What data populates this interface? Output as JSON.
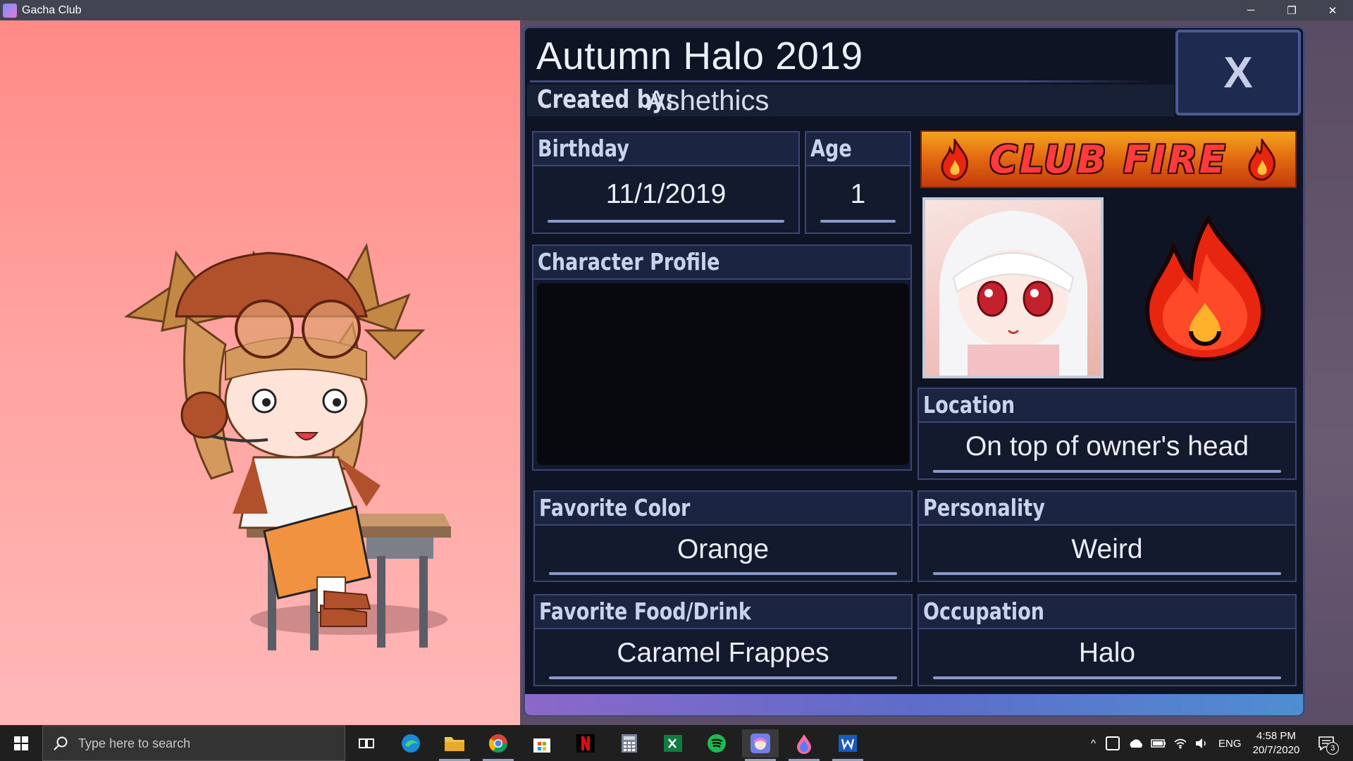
{
  "window": {
    "title": "Gacha Club",
    "minimize": "─",
    "restore": "❐",
    "close": "✕"
  },
  "card": {
    "title": "Autumn Halo 2019",
    "created_label": "Created by:",
    "created_by": "Ashethics",
    "close_label": "X"
  },
  "fields": {
    "birthday": {
      "label": "Birthday",
      "value": "11/1/2019"
    },
    "age": {
      "label": "Age",
      "value": "1"
    },
    "profile": {
      "label": "Character Profile",
      "value": ""
    },
    "location": {
      "label": "Location",
      "value": "On top of owner's head"
    },
    "favorite_color": {
      "label": "Favorite Color",
      "value": "Orange"
    },
    "personality": {
      "label": "Personality",
      "value": "Weird"
    },
    "favorite_food": {
      "label": "Favorite Food/Drink",
      "value": "Caramel Frappes"
    },
    "occupation": {
      "label": "Occupation",
      "value": "Halo"
    }
  },
  "club": {
    "banner_text": "CLUB FIRE",
    "emblem": "fire-icon"
  },
  "taskbar": {
    "search_placeholder": "Type here to search",
    "apps": [
      "task-view-icon",
      "edge-icon",
      "file-explorer-icon",
      "chrome-icon",
      "store-icon",
      "netflix-icon",
      "calculator-icon",
      "excel-icon",
      "spotify-icon",
      "gacha-club-icon",
      "paint-icon",
      "word-icon"
    ],
    "language": "ENG",
    "time": "4:58 PM",
    "date": "20/7/2020",
    "notifications": "3"
  },
  "colors": {
    "panel": "#0f1424",
    "field_border": "#3b4672",
    "scene_top": "#ff8a86",
    "scene_bottom": "#ffb8b7",
    "accent_fire": "#e8260f"
  }
}
